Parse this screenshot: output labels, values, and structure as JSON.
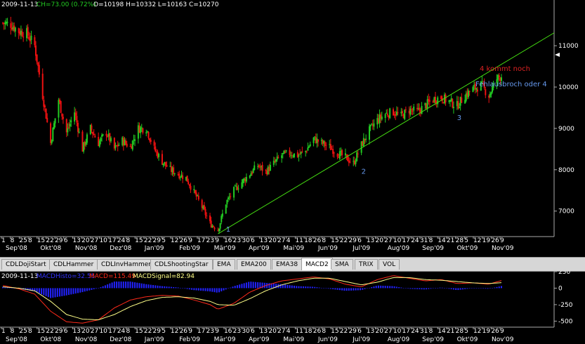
{
  "tabs": [
    {
      "label": "CDLDojiStart"
    },
    {
      "label": "CDLHammer"
    },
    {
      "label": "CDLInvHammer"
    },
    {
      "label": "CDLShootingStar"
    },
    {
      "label": "EMA"
    },
    {
      "label": "EMA200"
    },
    {
      "label": "EMA38"
    },
    {
      "label": "MACD2",
      "active": true
    },
    {
      "label": "SMA"
    },
    {
      "label": "TRIX"
    },
    {
      "label": "VOL"
    }
  ],
  "main_info": {
    "date": "2009-11-13",
    "change": "CH=73.00 (0.72%)",
    "ohlc": "O=10198 H=10332 L=10163 C=10270"
  },
  "macd_info": {
    "date": "2009-11-13",
    "hist": "MACDHisto=32.55",
    "macd": "MACD=115.49",
    "signal": "MACDSignal=82.94"
  },
  "annotations": {
    "p1": "1",
    "p2": "2",
    "p3": "3",
    "note_red": "4 kommt noch",
    "note_blue": "Fehlausbroch oder 4"
  },
  "colors": {
    "up": "#22cc22",
    "down": "#ee1111",
    "trend": "#44dd11",
    "macd": "#ff2a1a",
    "signal": "#ffff88",
    "hist": "#2222ff",
    "label_blue": "#6699ee",
    "note_red": "#dd2222"
  },
  "chart_data": [
    {
      "type": "candlestick",
      "y_ticks": [
        7000,
        8000,
        9000,
        10000,
        11000
      ],
      "ylim": [
        6400,
        11800
      ],
      "date_range": [
        "2008-09-01",
        "2009-11-13"
      ],
      "x_day_labels": [
        "1",
        "8",
        "25",
        "8",
        "15",
        "22",
        "29",
        "6",
        "13",
        "20",
        "27",
        "10",
        "17",
        "24",
        "8",
        "15",
        "22",
        "29",
        "5",
        "12",
        "26",
        "9",
        "17",
        "23",
        "9",
        "16",
        "23",
        "30",
        "6",
        "13",
        "20",
        "27",
        "4",
        "11",
        "18",
        "26",
        "8",
        "15",
        "22",
        "29",
        "6",
        "13",
        "20",
        "27",
        "10",
        "17",
        "24",
        "31",
        "8",
        "14",
        "21",
        "28",
        "5",
        "12",
        "19",
        "26",
        "9"
      ],
      "x_month_labels": [
        "Sep'08",
        "Okt'08",
        "Nov'08",
        "Dez'08",
        "Jan'09",
        "Feb'09",
        "Mär'09",
        "Apr'09",
        "Mai'09",
        "Jun'09",
        "Jul'09",
        "Aug'09",
        "Sep'09",
        "Okt'09",
        "Nov'09"
      ],
      "close_path": [
        [
          "2008-09-01",
          11550
        ],
        [
          "2008-09-08",
          11520
        ],
        [
          "2008-09-15",
          11350
        ],
        [
          "2008-09-22",
          11300
        ],
        [
          "2008-09-29",
          11000
        ],
        [
          "2008-10-06",
          9800
        ],
        [
          "2008-10-13",
          8650
        ],
        [
          "2008-10-20",
          9700
        ],
        [
          "2008-10-27",
          8900
        ],
        [
          "2008-11-03",
          9400
        ],
        [
          "2008-11-10",
          8500
        ],
        [
          "2008-11-17",
          9000
        ],
        [
          "2008-11-24",
          8650
        ],
        [
          "2008-12-01",
          8900
        ],
        [
          "2008-12-08",
          8500
        ],
        [
          "2008-12-15",
          8700
        ],
        [
          "2008-12-22",
          8550
        ],
        [
          "2008-12-29",
          9000
        ],
        [
          "2009-01-05",
          9000
        ],
        [
          "2009-01-12",
          8500
        ],
        [
          "2009-01-19",
          8200
        ],
        [
          "2009-01-26",
          8000
        ],
        [
          "2009-02-02",
          7900
        ],
        [
          "2009-02-09",
          7800
        ],
        [
          "2009-02-16",
          7450
        ],
        [
          "2009-02-23",
          7100
        ],
        [
          "2009-03-02",
          6700
        ],
        [
          "2009-03-09",
          6550
        ],
        [
          "2009-03-16",
          7200
        ],
        [
          "2009-03-23",
          7500
        ],
        [
          "2009-03-30",
          7700
        ],
        [
          "2009-04-06",
          7900
        ],
        [
          "2009-04-13",
          8100
        ],
        [
          "2009-04-20",
          7950
        ],
        [
          "2009-04-27",
          8150
        ],
        [
          "2009-05-04",
          8350
        ],
        [
          "2009-05-11",
          8400
        ],
        [
          "2009-05-18",
          8350
        ],
        [
          "2009-05-25",
          8450
        ],
        [
          "2009-06-01",
          8750
        ],
        [
          "2009-06-08",
          8650
        ],
        [
          "2009-06-15",
          8550
        ],
        [
          "2009-06-22",
          8400
        ],
        [
          "2009-06-29",
          8300
        ],
        [
          "2009-07-06",
          8150
        ],
        [
          "2009-07-13",
          8600
        ],
        [
          "2009-07-20",
          8950
        ],
        [
          "2009-07-27",
          9200
        ],
        [
          "2009-08-03",
          9350
        ],
        [
          "2009-08-10",
          9400
        ],
        [
          "2009-08-17",
          9300
        ],
        [
          "2009-08-24",
          9450
        ],
        [
          "2009-08-31",
          9400
        ],
        [
          "2009-09-07",
          9550
        ],
        [
          "2009-09-14",
          9700
        ],
        [
          "2009-09-21",
          9750
        ],
        [
          "2009-09-28",
          9650
        ],
        [
          "2009-10-05",
          9550
        ],
        [
          "2009-10-12",
          9800
        ],
        [
          "2009-10-19",
          9950
        ],
        [
          "2009-10-26",
          10050
        ],
        [
          "2009-11-02",
          9800
        ],
        [
          "2009-11-09",
          10200
        ],
        [
          "2009-11-13",
          10270
        ]
      ],
      "trendline": [
        [
          "2009-03-09",
          6450
        ],
        [
          "2009-11-13",
          10550
        ]
      ],
      "labels": [
        [
          "p1",
          "2009-03-16",
          6500
        ],
        [
          "p2",
          "2009-07-13",
          7900
        ],
        [
          "p3",
          "2009-10-05",
          9200
        ]
      ]
    },
    {
      "type": "line",
      "y_ticks": [
        250,
        0,
        -250,
        -500
      ],
      "ylim": [
        -570,
        260
      ],
      "series": [
        {
          "name": "MACD",
          "points": [
            [
              "2008-09-01",
              40
            ],
            [
              "2008-09-15",
              -10
            ],
            [
              "2008-09-29",
              -90
            ],
            [
              "2008-10-13",
              -350
            ],
            [
              "2008-10-27",
              -510
            ],
            [
              "2008-11-10",
              -530
            ],
            [
              "2008-11-24",
              -480
            ],
            [
              "2008-12-08",
              -300
            ],
            [
              "2008-12-22",
              -180
            ],
            [
              "2009-01-05",
              -130
            ],
            [
              "2009-01-19",
              -110
            ],
            [
              "2009-02-02",
              -120
            ],
            [
              "2009-02-16",
              -180
            ],
            [
              "2009-03-02",
              -250
            ],
            [
              "2009-03-09",
              -320
            ],
            [
              "2009-03-23",
              -230
            ],
            [
              "2009-04-06",
              -60
            ],
            [
              "2009-04-20",
              40
            ],
            [
              "2009-05-04",
              110
            ],
            [
              "2009-05-18",
              140
            ],
            [
              "2009-06-01",
              170
            ],
            [
              "2009-06-15",
              140
            ],
            [
              "2009-06-29",
              60
            ],
            [
              "2009-07-13",
              20
            ],
            [
              "2009-07-27",
              130
            ],
            [
              "2009-08-10",
              190
            ],
            [
              "2009-08-24",
              150
            ],
            [
              "2009-09-07",
              110
            ],
            [
              "2009-09-21",
              130
            ],
            [
              "2009-10-05",
              70
            ],
            [
              "2009-10-19",
              80
            ],
            [
              "2009-11-02",
              60
            ],
            [
              "2009-11-13",
              115
            ]
          ]
        },
        {
          "name": "MACDSignal",
          "points": [
            [
              "2008-09-01",
              20
            ],
            [
              "2008-09-15",
              0
            ],
            [
              "2008-09-29",
              -40
            ],
            [
              "2008-10-13",
              -200
            ],
            [
              "2008-10-27",
              -400
            ],
            [
              "2008-11-10",
              -470
            ],
            [
              "2008-11-24",
              -480
            ],
            [
              "2008-12-08",
              -400
            ],
            [
              "2008-12-22",
              -280
            ],
            [
              "2009-01-05",
              -190
            ],
            [
              "2009-01-19",
              -140
            ],
            [
              "2009-02-02",
              -130
            ],
            [
              "2009-02-16",
              -150
            ],
            [
              "2009-03-02",
              -200
            ],
            [
              "2009-03-09",
              -250
            ],
            [
              "2009-03-23",
              -260
            ],
            [
              "2009-04-06",
              -160
            ],
            [
              "2009-04-20",
              -40
            ],
            [
              "2009-05-04",
              50
            ],
            [
              "2009-05-18",
              110
            ],
            [
              "2009-06-01",
              150
            ],
            [
              "2009-06-15",
              150
            ],
            [
              "2009-06-29",
              100
            ],
            [
              "2009-07-13",
              50
            ],
            [
              "2009-07-27",
              90
            ],
            [
              "2009-08-10",
              160
            ],
            [
              "2009-08-24",
              160
            ],
            [
              "2009-09-07",
              130
            ],
            [
              "2009-09-21",
              120
            ],
            [
              "2009-10-05",
              100
            ],
            [
              "2009-10-19",
              80
            ],
            [
              "2009-11-02",
              70
            ],
            [
              "2009-11-13",
              83
            ]
          ]
        }
      ]
    }
  ]
}
